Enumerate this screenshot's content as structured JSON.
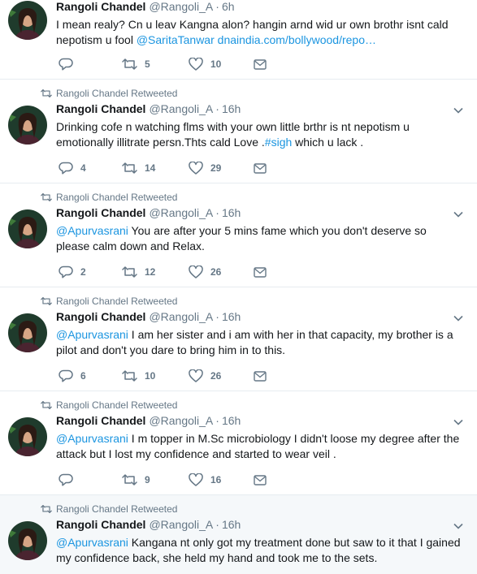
{
  "tweets": [
    {
      "retweet_context": "",
      "name": "Rangoli Chandel",
      "handle": "@Rangoli_A",
      "time": "6h",
      "text_1": "I mean realy? Cn u leav Kangna alon?  hangin arnd wid ur own brothr isnt cald nepotism u fool ",
      "mention": "@SaritaTanwar",
      "text_2": "  ",
      "link": "dnaindia.com/bollywood/repo…",
      "replies": "",
      "retweets": "5",
      "likes": "10"
    },
    {
      "retweet_context": "Rangoli Chandel Retweeted",
      "name": "Rangoli Chandel",
      "handle": "@Rangoli_A",
      "time": "16h",
      "text_1": "Drinking cofe n watching flms with your own little brthr is nt nepotism u emotionally illitrate persn.Thts cald Love .",
      "hashtag": "#sigh",
      "text_2": " which u lack .",
      "replies": "4",
      "retweets": "14",
      "likes": "29"
    },
    {
      "retweet_context": "Rangoli Chandel Retweeted",
      "name": "Rangoli Chandel",
      "handle": "@Rangoli_A",
      "time": "16h",
      "mention": "@Apurvasrani",
      "text_1": " You are after your 5 mins fame which you don't deserve so please calm down and Relax.",
      "replies": "2",
      "retweets": "12",
      "likes": "26"
    },
    {
      "retweet_context": "Rangoli Chandel Retweeted",
      "name": "Rangoli Chandel",
      "handle": "@Rangoli_A",
      "time": "16h",
      "mention": "@Apurvasrani",
      "text_1": " I am her sister and i am with her in that capacity, my brother is a pilot and don't you dare to bring him in to this.",
      "replies": "6",
      "retweets": "10",
      "likes": "26"
    },
    {
      "retweet_context": "Rangoli Chandel Retweeted",
      "name": "Rangoli Chandel",
      "handle": "@Rangoli_A",
      "time": "16h",
      "mention": "@Apurvasrani",
      "text_1": " I m topper in M.Sc microbiology I didn't loose my degree after the attack but I lost my confidence and started to wear veil .",
      "replies": "",
      "retweets": "9",
      "likes": "16"
    },
    {
      "retweet_context": "Rangoli Chandel Retweeted",
      "name": "Rangoli Chandel",
      "handle": "@Rangoli_A",
      "time": "16h",
      "mention": "@Apurvasrani",
      "text_1": " Kangana nt only got my treatment done but saw to it that I gained my confidence back, she held my hand and took me to the sets.",
      "replies": "",
      "retweets": "",
      "likes": ""
    }
  ],
  "colors": {
    "link": "#1b95e0",
    "meta": "#657786",
    "border": "#e6ecf0",
    "highlight_bg": "#f5f8fa"
  },
  "icons": [
    "retweet-icon",
    "reply-icon",
    "heart-icon",
    "message-icon",
    "chevron-down-icon"
  ]
}
